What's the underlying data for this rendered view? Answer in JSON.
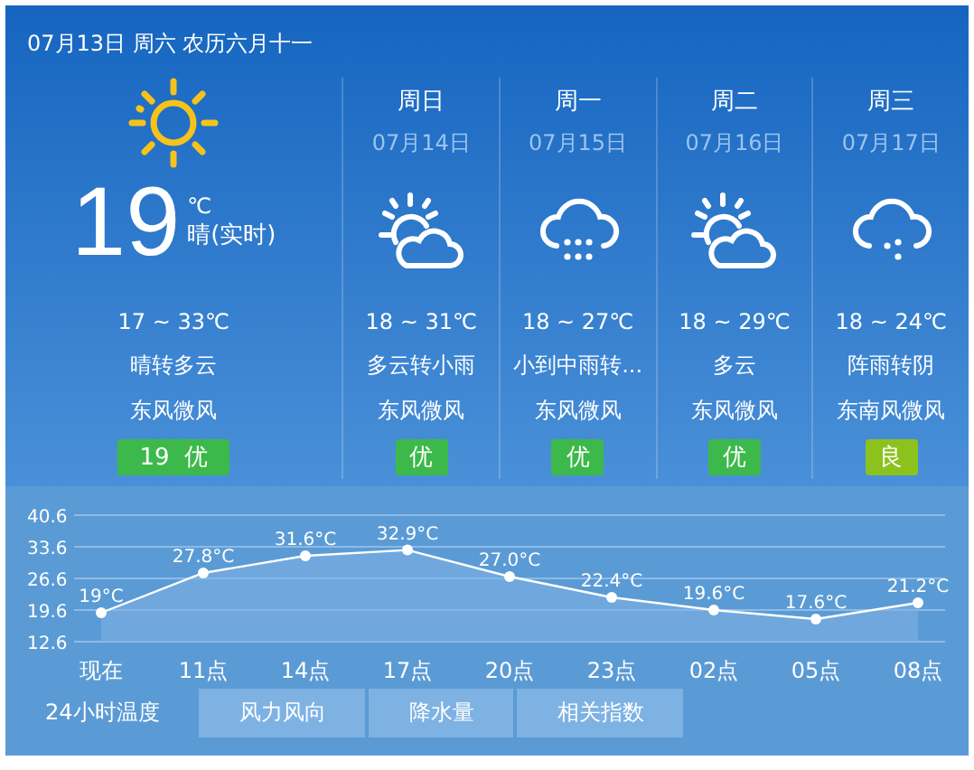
{
  "header": {
    "date": "07月13日 周六 农历六月十一"
  },
  "today": {
    "kind": "sunny",
    "temp": "19",
    "unit": "℃",
    "desc": "晴(实时)",
    "range": "17 ~ 33℃",
    "weather": "晴转多云",
    "wind": "东风微风",
    "aqi": {
      "label": "19  优",
      "color": "#3cb94a"
    }
  },
  "forecast": [
    {
      "day": "周日",
      "date": "07月14日",
      "kind": "partly-cloudy",
      "range": "18 ~ 31℃",
      "weather": "多云转小雨",
      "wind": "东风微风",
      "aqi": {
        "label": "优",
        "color": "#3cb94a"
      }
    },
    {
      "day": "周一",
      "date": "07月15日",
      "kind": "rain",
      "range": "18 ~ 27℃",
      "weather": "小到中雨转...",
      "wind": "东风微风",
      "aqi": {
        "label": "优",
        "color": "#3cb94a"
      }
    },
    {
      "day": "周二",
      "date": "07月16日",
      "kind": "partly-cloudy",
      "range": "18 ~ 29℃",
      "weather": "多云",
      "wind": "东风微风",
      "aqi": {
        "label": "优",
        "color": "#3cb94a"
      }
    },
    {
      "day": "周三",
      "date": "07月17日",
      "kind": "light-rain",
      "range": "18 ~ 24℃",
      "weather": "阵雨转阴",
      "wind": "东南风微风",
      "aqi": {
        "label": "良",
        "color": "#8cc21e"
      }
    }
  ],
  "chart": {
    "chart_data": {
      "type": "line",
      "categories": [
        "现在",
        "11点",
        "14点",
        "17点",
        "20点",
        "23点",
        "02点",
        "05点",
        "08点"
      ],
      "grid": true,
      "series": [
        {
          "color": "#ffffff",
          "marker": true,
          "values": [
            19,
            27.8,
            31.6,
            32.9,
            27.0,
            22.4,
            19.6,
            17.6,
            21.2
          ]
        }
      ],
      "ylim": [
        12.6,
        40.6
      ],
      "yticks": [
        12.6,
        19.6,
        26.6,
        33.6,
        40.6
      ],
      "value_labels": [
        "19°C",
        "27.8°C",
        "31.6°C",
        "32.9°C",
        "27.0°C",
        "22.4°C",
        "19.6°C",
        "17.6°C",
        "21.2°C"
      ]
    }
  },
  "tabs": [
    {
      "label": "24小时温度",
      "selected": true
    },
    {
      "label": "风力风向",
      "selected": false
    },
    {
      "label": "降水量",
      "selected": false
    },
    {
      "label": "相关指数",
      "selected": false
    }
  ]
}
